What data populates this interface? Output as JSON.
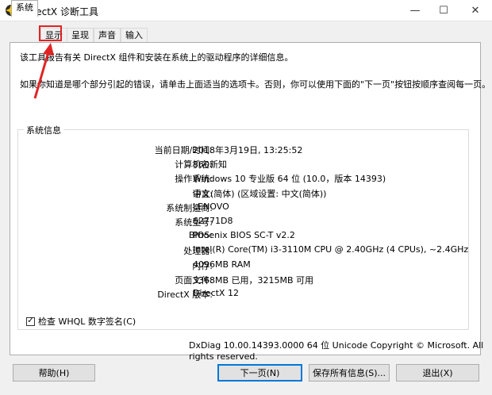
{
  "window": {
    "title": "DirectX 诊断工具",
    "minimize_label": "—",
    "maximize_label": "☐",
    "close_label": "✕"
  },
  "tabs": [
    {
      "label": "系统",
      "active": true
    },
    {
      "label": "显示",
      "active": false,
      "highlighted": true
    },
    {
      "label": "呈现",
      "active": false
    },
    {
      "label": "声音",
      "active": false
    },
    {
      "label": "输入",
      "active": false
    }
  ],
  "intro": {
    "line1": "该工具报告有关 DirectX 组件和安装在系统上的驱动程序的详细信息。",
    "line2": "如果你知道是哪个部分引起的错误，请单击上面适当的选项卡。否则，你可以使用下面的\"下一页\"按钮按顺序查阅每一页。"
  },
  "system_info": {
    "legend": "系统信息",
    "rows": [
      {
        "label": "当前日期/时间:",
        "value": "2018年3月19日, 13:25:52"
      },
      {
        "label": "计算机名:",
        "value": "360新知"
      },
      {
        "label": "操作系统:",
        "value": "Windows 10 专业版 64 位 (10.0，版本 14393)"
      },
      {
        "label": "语言:",
        "value": "中文(简体) (区域设置: 中文(简体))"
      },
      {
        "label": "系统制造商:",
        "value": "LENOVO"
      },
      {
        "label": "系统型号:",
        "value": "62771D8"
      },
      {
        "label": "BIOS:",
        "value": "Phoenix BIOS SC-T v2.2"
      },
      {
        "label": "处理器:",
        "value": "Intel(R) Core(TM) i3-3110M CPU @ 2.40GHz (4 CPUs), ~2.4GHz"
      },
      {
        "label": "内存:",
        "value": "4096MB RAM"
      },
      {
        "label": "页面文件:",
        "value": "3368MB 已用，3215MB 可用"
      },
      {
        "label": "DirectX 版本:",
        "value": "DirectX 12"
      }
    ]
  },
  "whql_check": {
    "label": "检查 WHQL 数字签名(C)",
    "checked": true,
    "mark": "✓"
  },
  "footer": {
    "version_info": "DxDiag 10.00.14393.0000 64 位 Unicode  Copyright © Microsoft. All rights reserved."
  },
  "buttons": {
    "help": "帮助(H)",
    "next": "下一页(N)",
    "save": "保存所有信息(S)...",
    "exit": "退出(X)"
  },
  "colors": {
    "highlight": "#e02424",
    "default_button_border": "#0078d7"
  }
}
